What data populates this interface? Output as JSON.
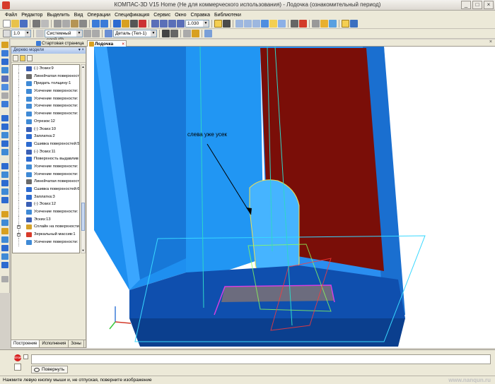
{
  "window": {
    "title": "КОМПАС-3D V15 Home (Не для коммерческого использования) - Лодочка (ознакомительный период)",
    "controls": [
      "_",
      "□",
      "×"
    ]
  },
  "menu": [
    {
      "label": "Файл"
    },
    {
      "label": "Редактор"
    },
    {
      "label": "Выделить"
    },
    {
      "label": "Вид"
    },
    {
      "label": "Операции"
    },
    {
      "label": "Спецификация"
    },
    {
      "label": "Сервис"
    },
    {
      "label": "Окно"
    },
    {
      "label": "Справка"
    },
    {
      "label": "Библиотеки"
    }
  ],
  "toolbar1": {
    "zoom_value": "1.030"
  },
  "toolbar2": {
    "line_width": "1.0",
    "layer": "Системный слой (0)",
    "part_selector": "Деталь (Тел-1)"
  },
  "doc_tabs": [
    {
      "label": "Стартовая страница",
      "active": false
    },
    {
      "label": "Лодочка",
      "active": true
    }
  ],
  "tree_panel": {
    "title": "Дерево модели",
    "pin": "▾ ×",
    "items": [
      {
        "label": "(-) Эскиз:9",
        "icon": "sketch-icon",
        "color": "#3a5fb5"
      },
      {
        "label": "Линейчатая поверхность",
        "icon": "ruled-surface-icon",
        "color": "#6a6a6a"
      },
      {
        "label": "Придать толщину:1",
        "icon": "thicken-icon",
        "color": "#3f8ad6"
      },
      {
        "label": "Усечение поверхности:",
        "icon": "trim-surface-icon",
        "color": "#3f8ad6"
      },
      {
        "label": "Усечение поверхности:",
        "icon": "trim-surface-icon",
        "color": "#3f8ad6"
      },
      {
        "label": "Усечение поверхности:",
        "icon": "trim-surface-icon",
        "color": "#3f8ad6"
      },
      {
        "label": "Усечение поверхности:",
        "icon": "trim-surface-icon",
        "color": "#3f8ad6"
      },
      {
        "label": "Отрезок:12",
        "icon": "segment-icon",
        "color": "#3f8ad6"
      },
      {
        "label": "(-) Эскиз:10",
        "icon": "sketch-icon",
        "color": "#3a5fb5"
      },
      {
        "label": "Заплатка:2",
        "icon": "patch-icon",
        "color": "#2d6bd0"
      },
      {
        "label": "Сшивка поверхностей:5",
        "icon": "sew-surfaces-icon",
        "color": "#2d6bd0"
      },
      {
        "label": "(-) Эскиз:11",
        "icon": "sketch-icon",
        "color": "#3a5fb5"
      },
      {
        "label": "Поверхность выдавлив",
        "icon": "extrude-surface-icon",
        "color": "#2d6bd0"
      },
      {
        "label": "Усечение поверхности:",
        "icon": "trim-surface-icon",
        "color": "#3f8ad6"
      },
      {
        "label": "Усечение поверхности:",
        "icon": "trim-surface-icon",
        "color": "#3f8ad6"
      },
      {
        "label": "Линейчатая поверхность",
        "icon": "ruled-surface-icon",
        "color": "#6a6a6a"
      },
      {
        "label": "Сшивка поверхностей:6",
        "icon": "sew-surfaces-icon",
        "color": "#2d6bd0"
      },
      {
        "label": "Заплатка:3",
        "icon": "patch-icon",
        "color": "#2d6bd0"
      },
      {
        "label": "(-) Эскиз:12",
        "icon": "sketch-icon",
        "color": "#3a5fb5"
      },
      {
        "label": "Усечение поверхности:",
        "icon": "trim-surface-icon",
        "color": "#3f8ad6"
      },
      {
        "label": "Эскиз:13",
        "icon": "sketch-icon",
        "color": "#3a5fb5"
      },
      {
        "label": "Сплайн на поверхности",
        "icon": "spline-icon",
        "color": "#d4a12a",
        "expandable": true
      },
      {
        "label": "Зеркальный массив:1",
        "icon": "mirror-array-icon",
        "color": "#d83a2a",
        "expandable": true
      },
      {
        "label": "Усечение поверхности:",
        "icon": "trim-surface-icon",
        "color": "#3f8ad6"
      }
    ],
    "tabs": [
      "Построение",
      "Исполнения",
      "Зоны"
    ]
  },
  "viewport": {
    "annotation": "слева уже усек"
  },
  "bottom_panel": {
    "stop_label": "STOP",
    "rotate_label": "Повернуть"
  },
  "status_bar": {
    "hint": "Нажмите левую кнопку мыши и, не отпуская, поверните изображение",
    "watermark": "www.nanqun.ru"
  }
}
